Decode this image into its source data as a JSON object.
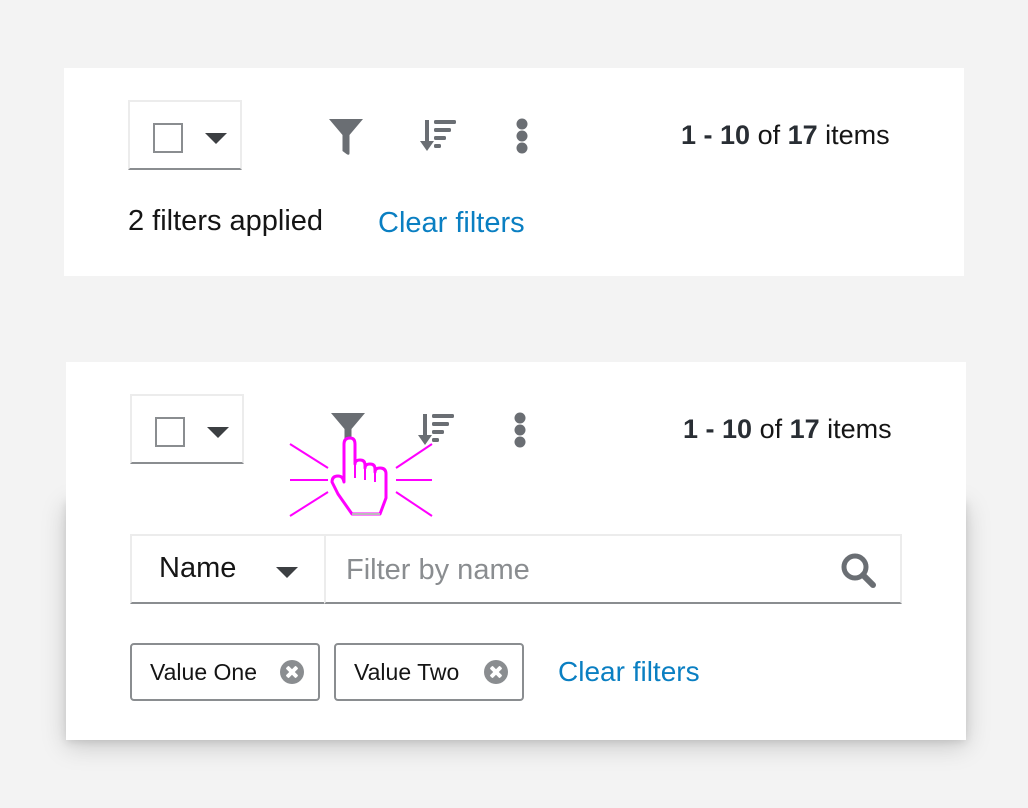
{
  "toolbar_collapsed": {
    "bulk_select": {
      "checked": false,
      "icon": "caret-down-icon"
    },
    "icons": [
      "filter-icon",
      "sort-amount-down-icon",
      "kebab-menu-icon"
    ],
    "pagination": {
      "range_start": "1",
      "range_sep": " - ",
      "range_end": "10",
      "of": " of ",
      "total": "17",
      "items": " items"
    },
    "filters_applied": "2 filters applied",
    "clear_filters": "Clear filters"
  },
  "toolbar_expanded": {
    "bulk_select": {
      "checked": false,
      "icon": "caret-down-icon"
    },
    "icons": [
      "filter-icon",
      "sort-amount-down-icon",
      "kebab-menu-icon"
    ],
    "pagination": {
      "range_start": "1",
      "range_sep": " - ",
      "range_end": "10",
      "of": " of ",
      "total": "17",
      "items": " items"
    },
    "filter_panel": {
      "attribute": "Name",
      "search_placeholder": "Filter by name",
      "search_value": "",
      "chips": [
        {
          "label": "Value One"
        },
        {
          "label": "Value Two"
        }
      ],
      "clear_filters": "Clear filters"
    },
    "cursor": "pointer-hand-click"
  },
  "colors": {
    "background": "#f3f3f3",
    "card": "#ffffff",
    "link": "#0a7fc2",
    "icon": "#6a6e73",
    "text": "#151515",
    "cursor_highlight": "#ff00ff"
  }
}
